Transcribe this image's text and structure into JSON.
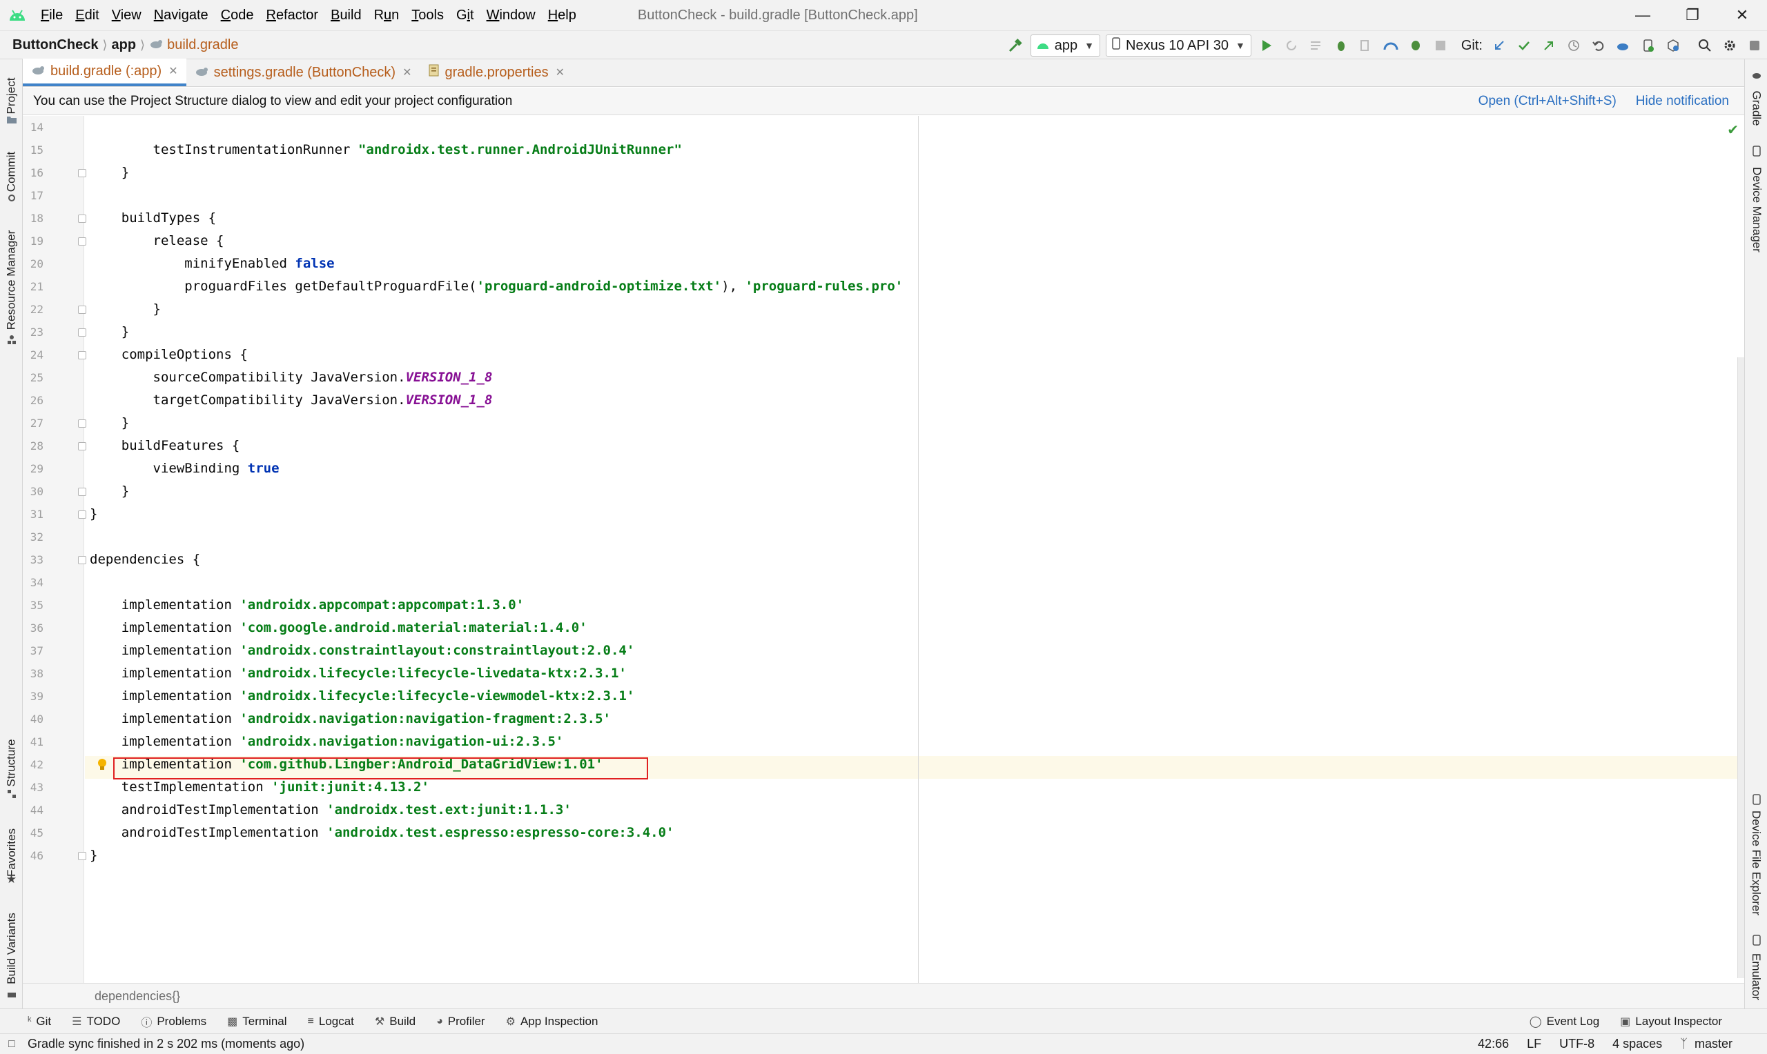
{
  "menu": {
    "items": [
      "File",
      "Edit",
      "View",
      "Navigate",
      "Code",
      "Refactor",
      "Build",
      "Run",
      "Tools",
      "Git",
      "Window",
      "Help"
    ],
    "mnemonics": [
      "F",
      "E",
      "V",
      "N",
      "C",
      "R",
      "B",
      "u",
      "T",
      "i",
      "W",
      "H"
    ],
    "window_title": "ButtonCheck - build.gradle [ButtonCheck.app]"
  },
  "nav": {
    "project": "ButtonCheck",
    "module": "app",
    "file": "build.gradle",
    "run_config": "app",
    "device": "Nexus 10 API 30",
    "git_label": "Git:"
  },
  "left_tools": [
    "Project",
    "Commit",
    "Resource Manager",
    "Structure",
    "Favorites",
    "Build Variants"
  ],
  "right_tools": [
    "Gradle",
    "Device Manager",
    "Device File Explorer",
    "Emulator"
  ],
  "tabs": [
    {
      "label": "build.gradle (:app)",
      "active": true
    },
    {
      "label": "settings.gradle (ButtonCheck)",
      "active": false
    },
    {
      "label": "gradle.properties",
      "active": false
    }
  ],
  "notification": {
    "text": "You can use the Project Structure dialog to view and edit your project configuration",
    "open_link": "Open (Ctrl+Alt+Shift+S)",
    "hide_link": "Hide notification"
  },
  "editor": {
    "lines": [
      {
        "n": "14",
        "code": ""
      },
      {
        "n": "15",
        "code": "        testInstrumentationRunner \"androidx.test.runner.AndroidJUnitRunner\""
      },
      {
        "n": "16",
        "code": "    }"
      },
      {
        "n": "17",
        "code": ""
      },
      {
        "n": "18",
        "code": "    buildTypes {"
      },
      {
        "n": "19",
        "code": "        release {"
      },
      {
        "n": "20",
        "code": "            minifyEnabled false"
      },
      {
        "n": "21",
        "code": "            proguardFiles getDefaultProguardFile('proguard-android-optimize.txt'), 'proguard-rules.pro'"
      },
      {
        "n": "22",
        "code": "        }"
      },
      {
        "n": "23",
        "code": "    }"
      },
      {
        "n": "24",
        "code": "    compileOptions {"
      },
      {
        "n": "25",
        "code": "        sourceCompatibility JavaVersion.VERSION_1_8"
      },
      {
        "n": "26",
        "code": "        targetCompatibility JavaVersion.VERSION_1_8"
      },
      {
        "n": "27",
        "code": "    }"
      },
      {
        "n": "28",
        "code": "    buildFeatures {"
      },
      {
        "n": "29",
        "code": "        viewBinding true"
      },
      {
        "n": "30",
        "code": "    }"
      },
      {
        "n": "31",
        "code": "}"
      },
      {
        "n": "32",
        "code": ""
      },
      {
        "n": "33",
        "code": "dependencies {"
      },
      {
        "n": "34",
        "code": ""
      },
      {
        "n": "35",
        "code": "    implementation 'androidx.appcompat:appcompat:1.3.0'"
      },
      {
        "n": "36",
        "code": "    implementation 'com.google.android.material:material:1.4.0'"
      },
      {
        "n": "37",
        "code": "    implementation 'androidx.constraintlayout:constraintlayout:2.0.4'"
      },
      {
        "n": "38",
        "code": "    implementation 'androidx.lifecycle:lifecycle-livedata-ktx:2.3.1'"
      },
      {
        "n": "39",
        "code": "    implementation 'androidx.lifecycle:lifecycle-viewmodel-ktx:2.3.1'"
      },
      {
        "n": "40",
        "code": "    implementation 'androidx.navigation:navigation-fragment:2.3.5'"
      },
      {
        "n": "41",
        "code": "    implementation 'androidx.navigation:navigation-ui:2.3.5'"
      },
      {
        "n": "42",
        "code": "    implementation 'com.github.Lingber:Android_DataGridView:1.01'"
      },
      {
        "n": "43",
        "code": "    testImplementation 'junit:junit:4.13.2'"
      },
      {
        "n": "44",
        "code": "    androidTestImplementation 'androidx.test.ext:junit:1.1.3'"
      },
      {
        "n": "45",
        "code": "    androidTestImplementation 'androidx.test.espresso:espresso-core:3.4.0'"
      },
      {
        "n": "46",
        "code": "}"
      }
    ],
    "highlighted_line": "42",
    "code_breadcrumb": "dependencies{}"
  },
  "bottom_tools": [
    "Git",
    "TODO",
    "Problems",
    "Terminal",
    "Logcat",
    "Build",
    "Profiler",
    "App Inspection"
  ],
  "bottom_tools_right": [
    "Event Log",
    "Layout Inspector"
  ],
  "status": {
    "message": "Gradle sync finished in 2 s 202 ms (moments ago)",
    "position": "42:66",
    "line_sep": "LF",
    "encoding": "UTF-8",
    "indent": "4 spaces",
    "branch": "master"
  },
  "colors": {
    "string": "#067d17",
    "keyword": "#0033b3",
    "constant": "#871094",
    "highlight_box": "#e02020",
    "file_tab": "#b65d1b",
    "link": "#2a6fc1"
  }
}
